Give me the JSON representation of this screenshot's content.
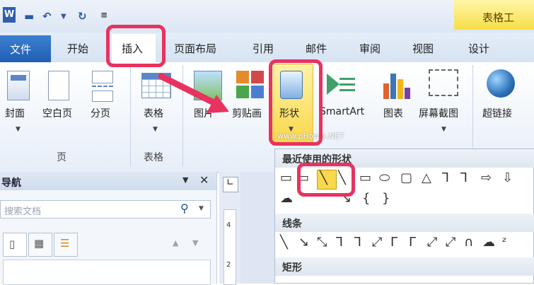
{
  "title_bar": {
    "contextual_tab": "表格工"
  },
  "tabs": [
    {
      "label": "文件"
    },
    {
      "label": "开始"
    },
    {
      "label": "插入"
    },
    {
      "label": "页面布局"
    },
    {
      "label": "引用"
    },
    {
      "label": "邮件"
    },
    {
      "label": "审阅"
    },
    {
      "label": "视图"
    },
    {
      "label": "设计"
    }
  ],
  "ribbon": {
    "pages_group": {
      "name": "页",
      "buttons": [
        "封面",
        "空白页",
        "分页"
      ]
    },
    "tables_group": {
      "name": "表格",
      "buttons": [
        "表格"
      ]
    },
    "illustrations": [
      "图片",
      "剪贴画",
      "形状",
      "SmartArt",
      "图表",
      "屏幕截图"
    ],
    "links": [
      "超链接"
    ]
  },
  "watermark": "www.pHome.NET",
  "shapes_panel": {
    "recent_header": "最近使用的形状",
    "lines_header": "线条",
    "rect_header": "矩形",
    "recent_row1": [
      "▭",
      "▭",
      "╲",
      "╲",
      "▭",
      "⬭",
      "▢",
      "△",
      "ᒣ",
      "ᒣ",
      "⇨",
      "⇩"
    ],
    "recent_row2": [
      "☁",
      "↘",
      "{",
      "}"
    ],
    "lines_row": [
      "╲",
      "↘",
      "⤡",
      "ᒣ",
      "ᒣ",
      "⤢",
      "ᒥ",
      "ᒥ",
      "⤢",
      "⤢",
      "∩",
      "☁",
      "ᶻ"
    ]
  },
  "nav_pane": {
    "title": "导航",
    "search_placeholder": "搜索文档"
  },
  "ruler": {
    "marks": [
      "4",
      "2"
    ]
  },
  "colors": {
    "highlight": "#e8325f",
    "file_tab": "#2a66bf",
    "shape_button": "#f9d84c"
  }
}
